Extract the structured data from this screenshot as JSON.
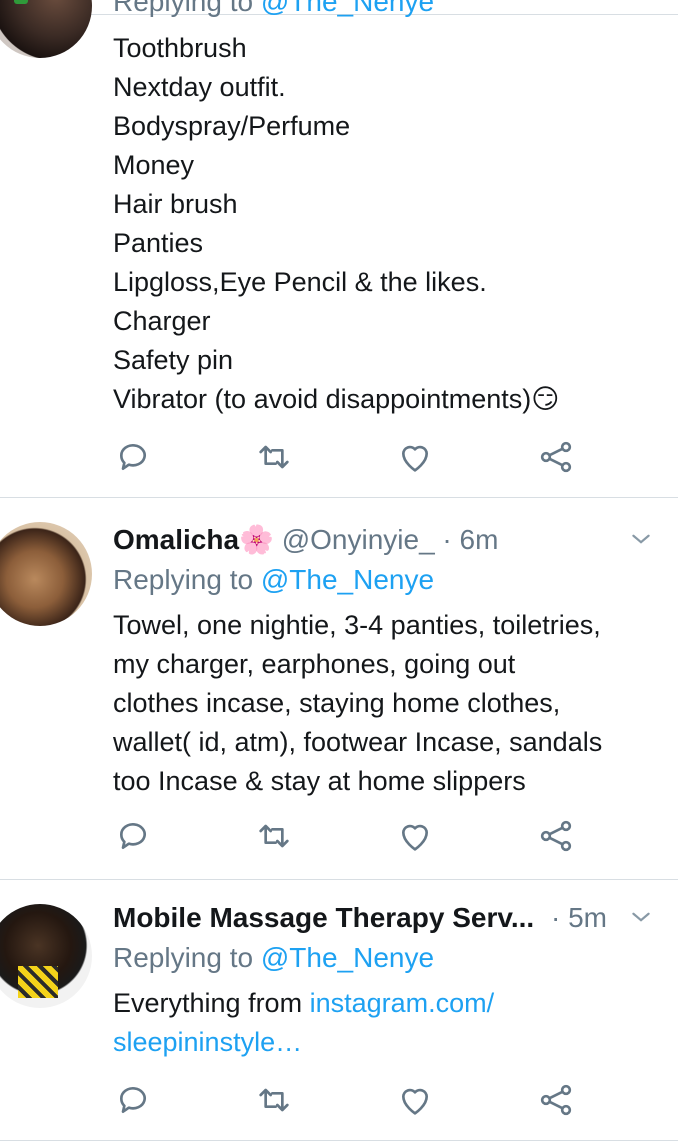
{
  "tweets": [
    {
      "reply_prefix": "Replying to",
      "mention": "@The_Nenye",
      "lines": [
        "Toothbrush",
        "Nextday outfit.",
        "Bodyspray/Perfume",
        "Money",
        "Hair brush",
        "Panties",
        "Lipgloss,Eye Pencil & the likes.",
        "Charger",
        "Safety pin",
        "Vibrator (to avoid disappointments)😏"
      ]
    },
    {
      "name": "Omalicha🌸",
      "handle": "@Onyinyie_",
      "time": "· 6m",
      "reply_prefix": "Replying to",
      "mention": "@The_Nenye",
      "lines": [
        "Towel, one nightie, 3-4 panties, toiletries,",
        "my charger, earphones, going out",
        "clothes incase, staying home clothes,",
        "wallet( id, atm), footwear Incase, sandals",
        "too Incase & stay at home slippers"
      ]
    },
    {
      "name": "Mobile Massage Therapy Serv...",
      "time": "· 5m",
      "reply_prefix": "Replying to",
      "mention": "@The_Nenye",
      "text_prefix": "Everything from ",
      "link_line1": "instagram.com/",
      "link_line2": "sleepininstyle…"
    }
  ],
  "icons": {
    "reply": "reply-icon",
    "retweet": "retweet-icon",
    "like": "like-icon",
    "share": "share-icon",
    "more": "chevron-down-icon"
  },
  "colors": {
    "link": "#1da1f2",
    "muted": "#657786",
    "icon": "#657786",
    "divider": "#d8dee3"
  }
}
